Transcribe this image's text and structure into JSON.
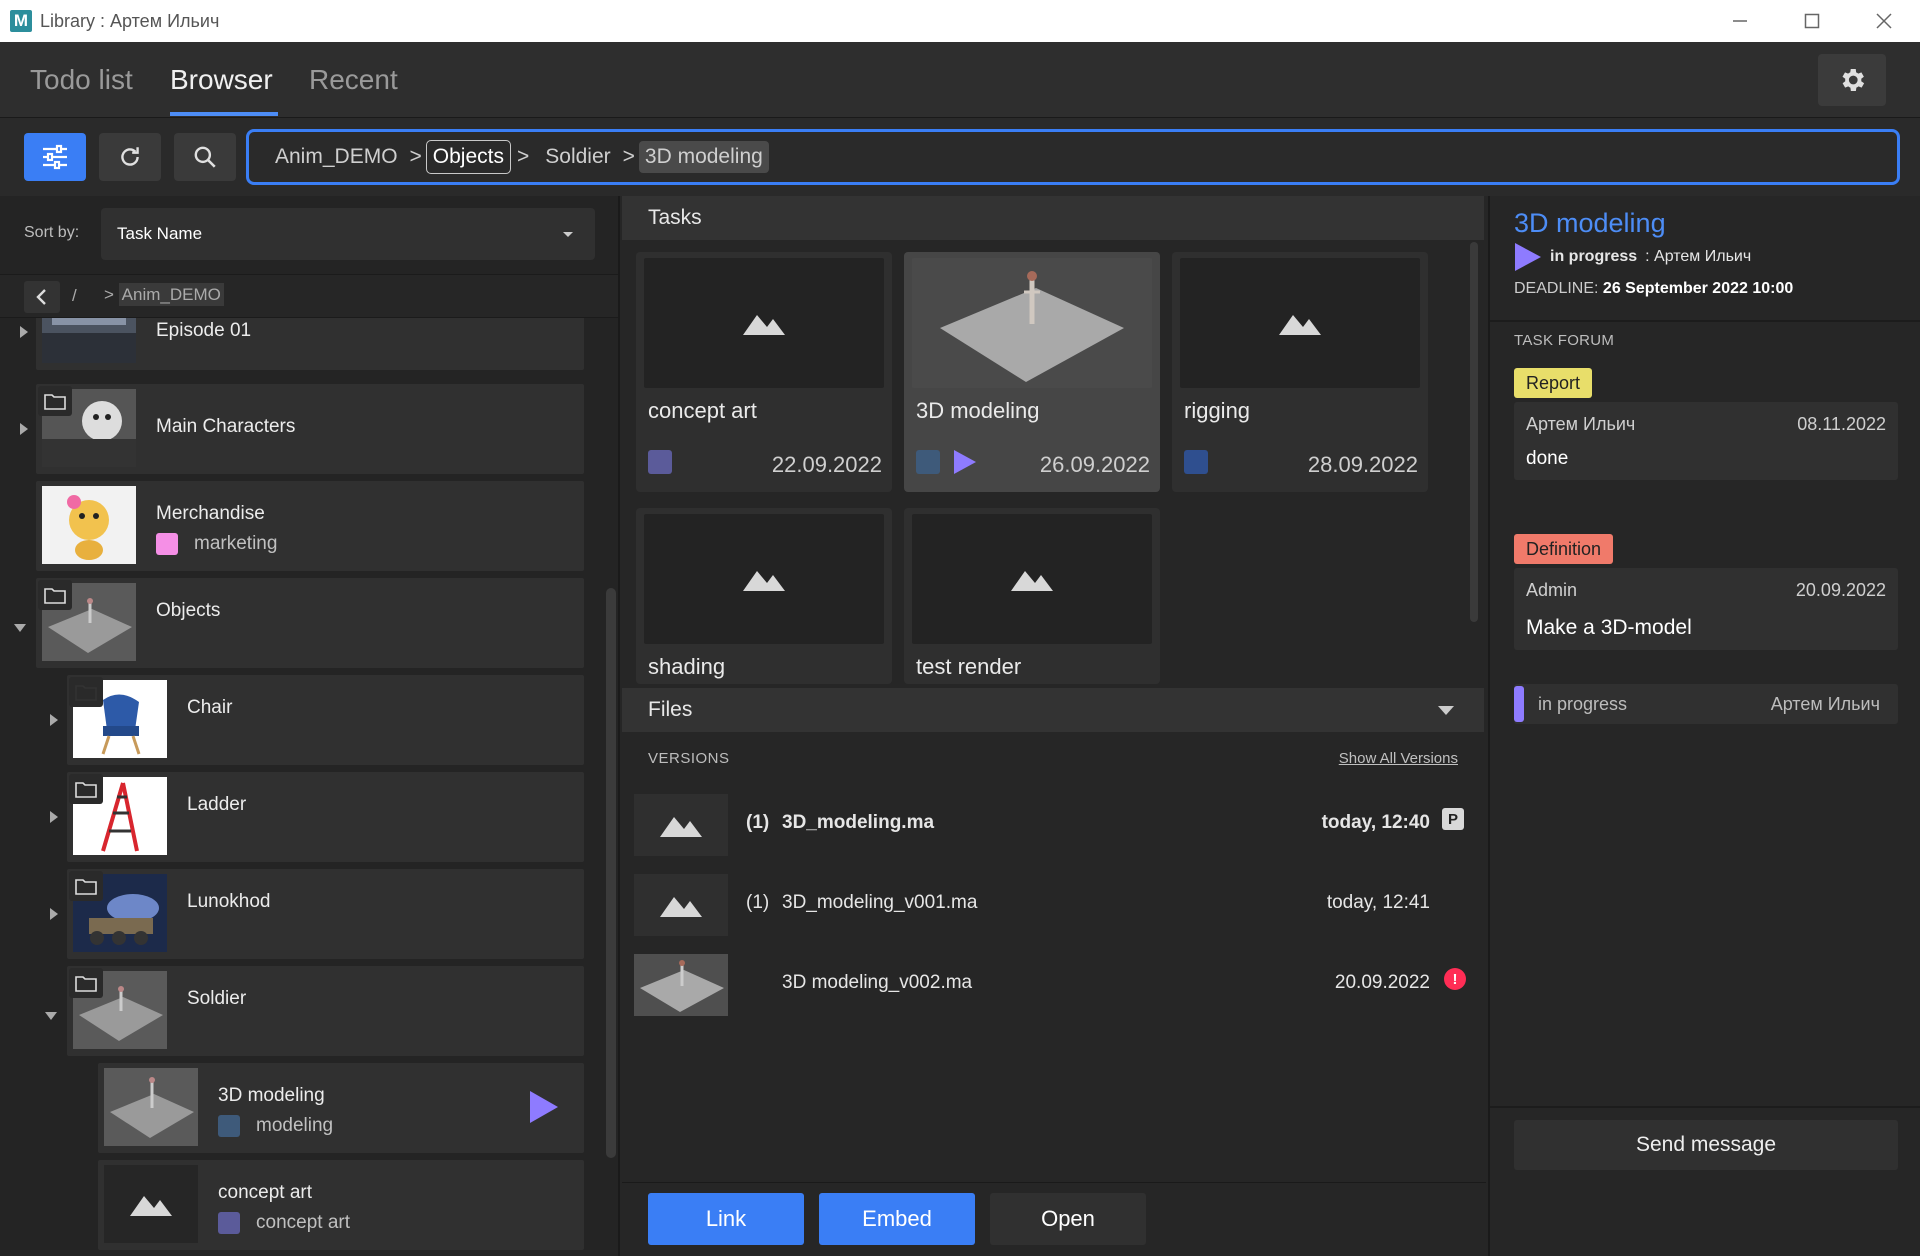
{
  "window": {
    "app_logo": "M",
    "title": "Library : Артем Ильич"
  },
  "tabs": {
    "todo": "Todo list",
    "browser": "Browser",
    "recent": "Recent",
    "active": "Browser"
  },
  "toolbar": {
    "breadcrumbs": [
      "Anim_DEMO",
      "Objects",
      "Soldier",
      "3D modeling"
    ],
    "separator": ">"
  },
  "sidebar": {
    "sort_label": "Sort by:",
    "sort_value": "Task Name",
    "nav_slash": "/",
    "nav_sep": ">",
    "nav_crumb": "Anim_DEMO",
    "items": [
      {
        "label": "Episode 01"
      },
      {
        "label": "Main Characters"
      },
      {
        "label": "Merchandise",
        "tag": "marketing",
        "tag_color": "#f58fe6"
      },
      {
        "label": "Objects"
      },
      {
        "label": "Chair"
      },
      {
        "label": "Ladder"
      },
      {
        "label": "Lunokhod"
      },
      {
        "label": "Soldier"
      },
      {
        "label": "3D modeling",
        "tag": "modeling",
        "tag_color": "#3e5a7a"
      },
      {
        "label": "concept art",
        "tag": "concept art",
        "tag_color": "#5b5b9a"
      }
    ]
  },
  "tasks": {
    "header": "Tasks",
    "cards": [
      {
        "name": "concept art",
        "date": "22.09.2022",
        "color": "#5b5b9a"
      },
      {
        "name": "3D modeling",
        "date": "26.09.2022",
        "color": "#3e5a7a",
        "selected": true
      },
      {
        "name": "rigging",
        "date": "28.09.2022",
        "color": "#2f4f8f"
      },
      {
        "name": "shading",
        "date": ""
      },
      {
        "name": "test render",
        "date": ""
      }
    ]
  },
  "files": {
    "header": "Files",
    "versions_label": "VERSIONS",
    "show_all": "Show All Versions",
    "rows": [
      {
        "num": "(1)",
        "name": "3D_modeling.ma",
        "date": "today, 12:40",
        "badge": "P"
      },
      {
        "num": "(1)",
        "name": "3D_modeling_v001.ma",
        "date": "today, 12:41"
      },
      {
        "num": "",
        "name": "3D modeling_v002.ma",
        "date": "20.09.2022",
        "badge": "!"
      }
    ]
  },
  "actions": {
    "link": "Link",
    "embed": "Embed",
    "open": "Open"
  },
  "detail": {
    "title": "3D modeling",
    "status": "in progress",
    "status_user": ": Артем Ильич",
    "deadline_label": "DEADLINE:",
    "deadline_value": "26 September 2022 10:00",
    "forum_label": "TASK FORUM",
    "report_badge": "Report",
    "report_author": "Артем Ильич",
    "report_date": "08.11.2022",
    "report_text": "done",
    "status_change": "in progress",
    "status_change_user": "Артем Ильич",
    "definition_badge": "Definition",
    "definition_author": "Admin",
    "definition_date": "20.09.2022",
    "definition_text": "Make a 3D-model",
    "send_button": "Send message"
  },
  "colors": {
    "accent": "#3a7ef5",
    "title_blue": "#4d8df6",
    "status_purple": "#8e7bff",
    "report_yellow": "#e8de6a",
    "definition_red": "#f07a6a",
    "error_red": "#ff2d55"
  }
}
